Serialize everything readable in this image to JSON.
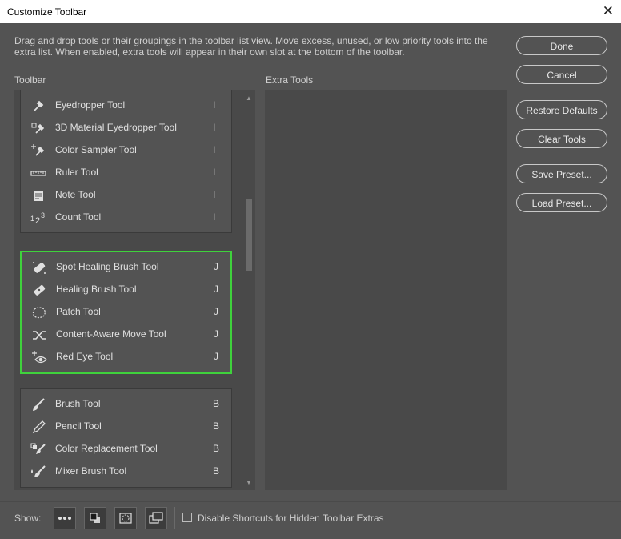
{
  "window": {
    "title": "Customize Toolbar",
    "close_glyph": "✕"
  },
  "description": "Drag and drop tools or their groupings in the toolbar list view. Move excess, unused, or low priority tools into the extra list. When enabled, extra tools will appear in their own slot at the bottom of the toolbar.",
  "toolbar_label": "Toolbar",
  "extra_label": "Extra Tools",
  "buttons": {
    "done": "Done",
    "cancel": "Cancel",
    "restore": "Restore Defaults",
    "clear": "Clear Tools",
    "save_preset": "Save Preset...",
    "load_preset": "Load Preset..."
  },
  "groups": [
    {
      "tools": [
        {
          "name": "Eyedropper Tool",
          "key": "I",
          "icon": "eyedropper-icon"
        },
        {
          "name": "3D Material Eyedropper Tool",
          "key": "I",
          "icon": "3d-eyedropper-icon"
        },
        {
          "name": "Color Sampler Tool",
          "key": "I",
          "icon": "color-sampler-icon"
        },
        {
          "name": "Ruler Tool",
          "key": "I",
          "icon": "ruler-icon"
        },
        {
          "name": "Note Tool",
          "key": "I",
          "icon": "note-icon"
        },
        {
          "name": "Count Tool",
          "key": "I",
          "icon": "count-icon"
        }
      ]
    },
    {
      "selected": true,
      "tools": [
        {
          "name": "Spot Healing Brush Tool",
          "key": "J",
          "icon": "spot-healing-icon"
        },
        {
          "name": "Healing Brush Tool",
          "key": "J",
          "icon": "healing-brush-icon"
        },
        {
          "name": "Patch Tool",
          "key": "J",
          "icon": "patch-icon"
        },
        {
          "name": "Content-Aware Move Tool",
          "key": "J",
          "icon": "content-aware-move-icon"
        },
        {
          "name": "Red Eye Tool",
          "key": "J",
          "icon": "red-eye-icon"
        }
      ]
    },
    {
      "tools": [
        {
          "name": "Brush Tool",
          "key": "B",
          "icon": "brush-icon"
        },
        {
          "name": "Pencil Tool",
          "key": "B",
          "icon": "pencil-icon"
        },
        {
          "name": "Color Replacement Tool",
          "key": "B",
          "icon": "color-replacement-icon"
        },
        {
          "name": "Mixer Brush Tool",
          "key": "B",
          "icon": "mixer-brush-icon"
        }
      ]
    }
  ],
  "show_label": "Show:",
  "show_buttons": [
    "more-icon",
    "foreground-background-icon",
    "quick-mask-icon",
    "screen-mode-icon"
  ],
  "disable_shortcuts_label": "Disable Shortcuts for Hidden Toolbar Extras",
  "disable_shortcuts_checked": false,
  "selection_color": "#3fd23c"
}
